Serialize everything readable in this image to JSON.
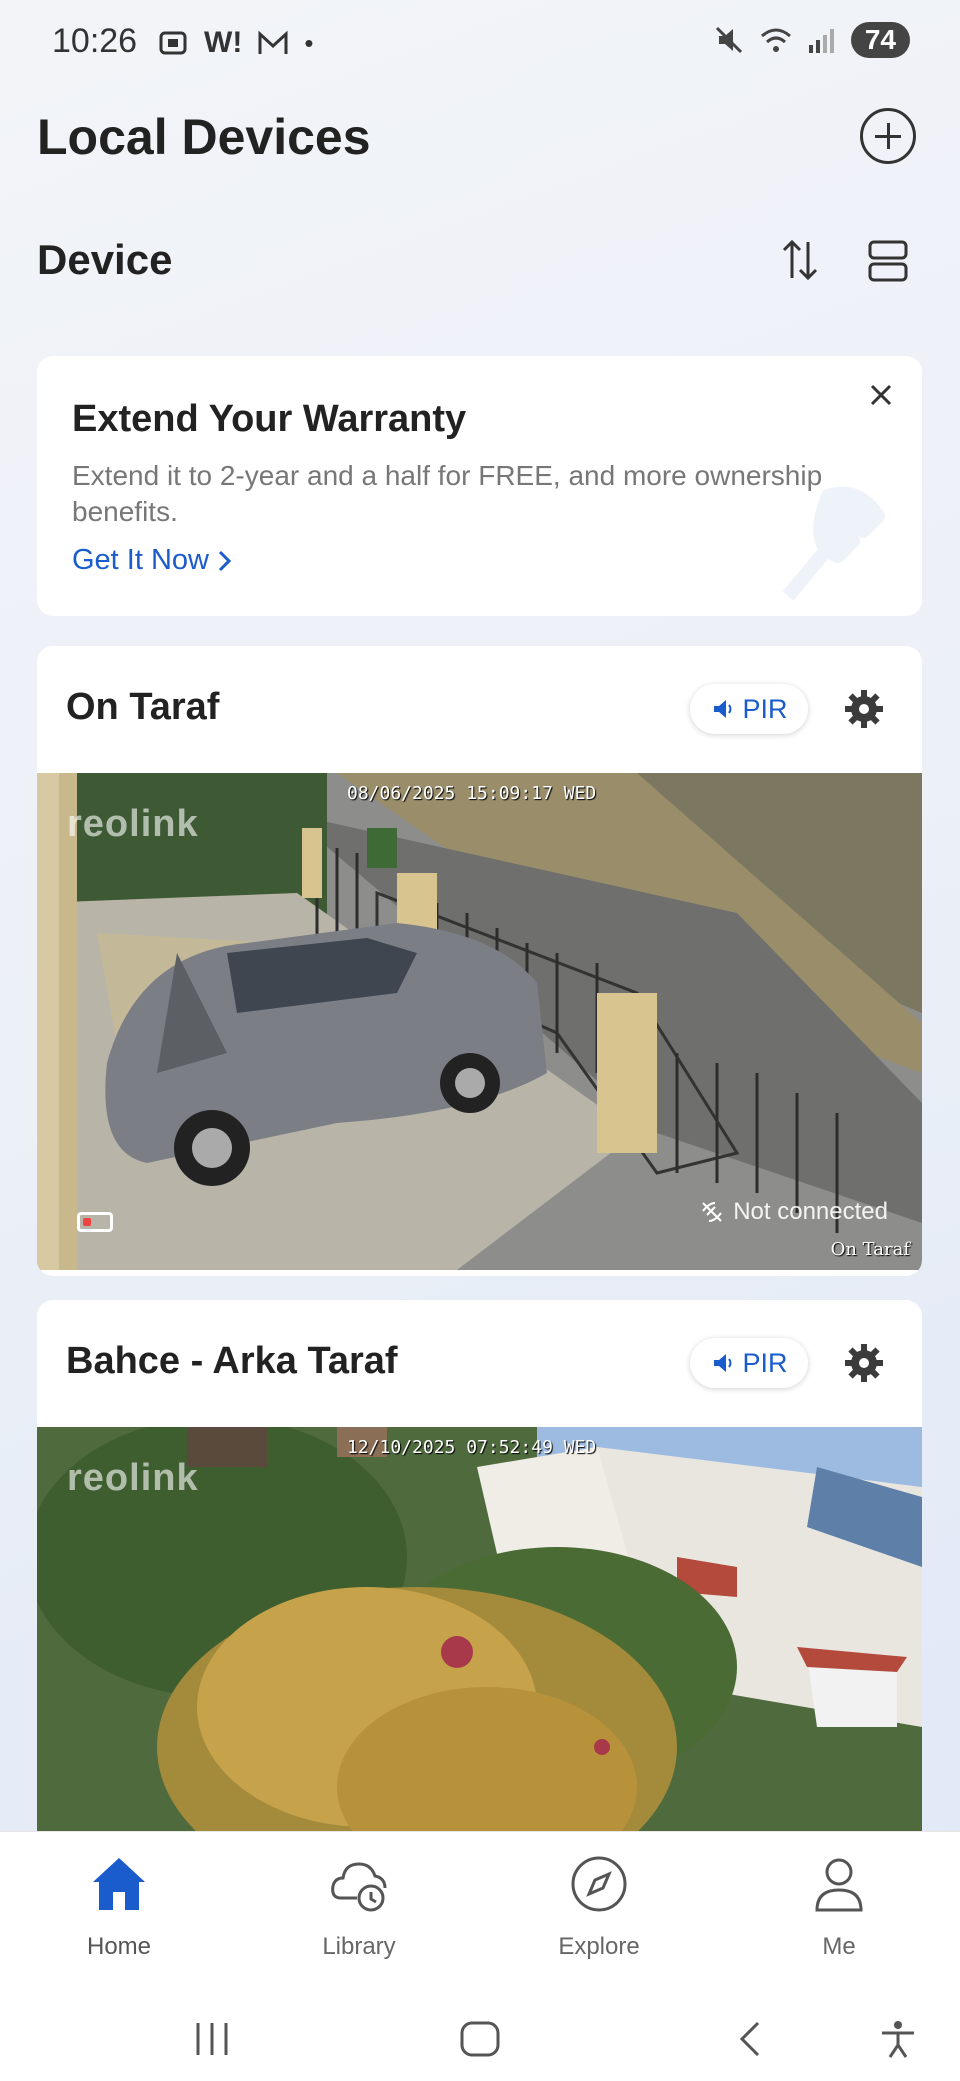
{
  "status_bar": {
    "time": "10:26",
    "left_icons": [
      "screenshot-icon",
      "w-icon",
      "gmail-icon",
      "dot-icon"
    ],
    "right_icons": [
      "mute-icon",
      "wifi-icon",
      "signal-icon"
    ],
    "battery": "74"
  },
  "header": {
    "title": "Local Devices",
    "add_icon": "plus-circle-icon"
  },
  "section": {
    "title": "Device",
    "sort_icon": "sort-icon",
    "layout_icon": "list-layout-icon"
  },
  "promo": {
    "title": "Extend Your Warranty",
    "description": "Extend it to 2-year and a half for FREE, and more ownership benefits.",
    "cta": "Get It Now"
  },
  "devices": [
    {
      "name": "On Taraf",
      "pir_label": "PIR",
      "timestamp": "08/06/2025 15:09:17 WED",
      "logo": "reolink",
      "status": "Not connected",
      "camera_label": "On Taraf"
    },
    {
      "name": "Bahce - Arka Taraf",
      "pir_label": "PIR",
      "timestamp": "12/10/2025 07:52:49 WED",
      "logo": "reolink"
    }
  ],
  "nav": {
    "items": [
      {
        "label": "Home",
        "icon": "home-icon",
        "active": true
      },
      {
        "label": "Library",
        "icon": "cloud-clock-icon"
      },
      {
        "label": "Explore",
        "icon": "compass-icon"
      },
      {
        "label": "Me",
        "icon": "user-icon"
      }
    ]
  },
  "colors": {
    "accent": "#1a5ccc",
    "text": "#222222",
    "muted": "#777777"
  }
}
